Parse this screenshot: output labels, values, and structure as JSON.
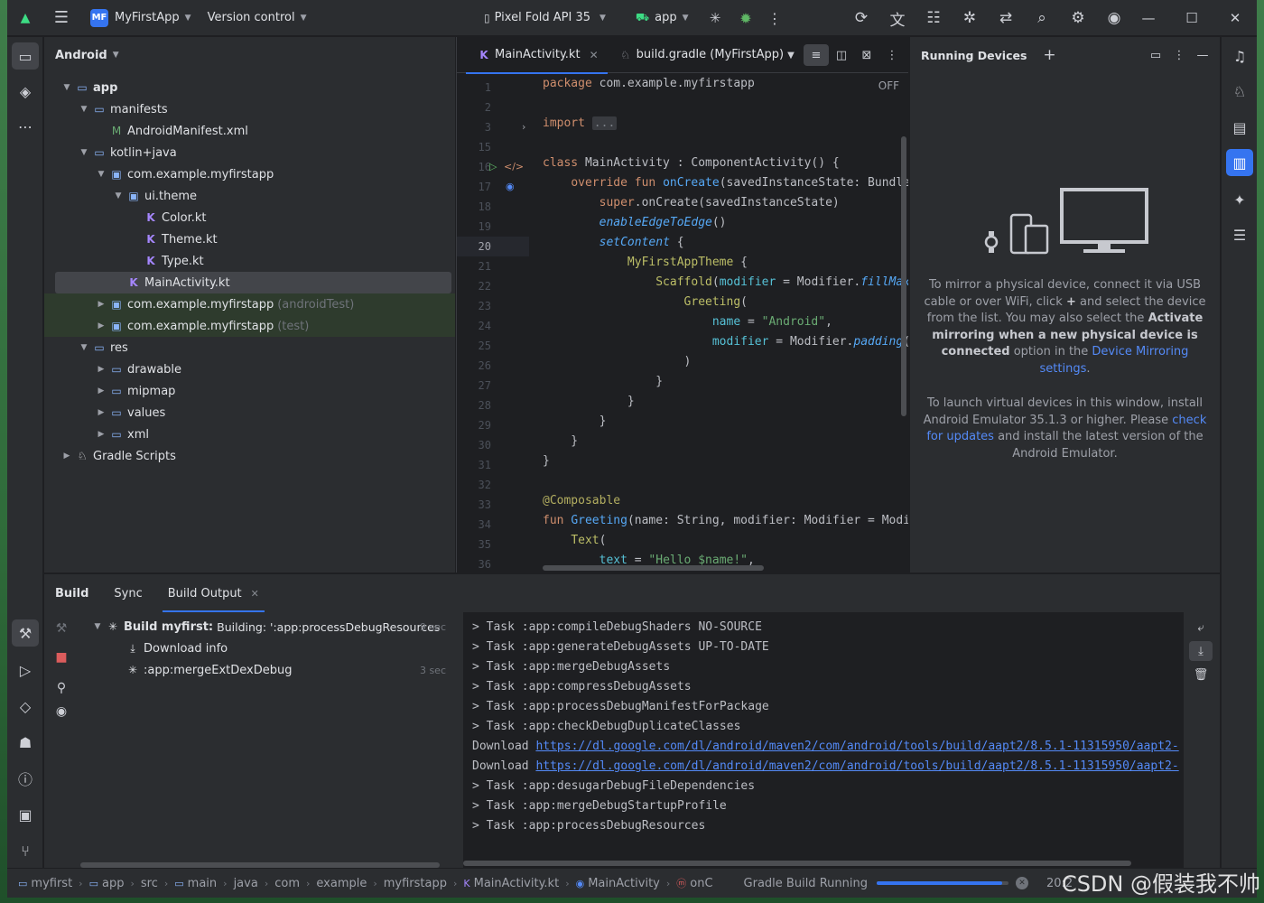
{
  "titlebar": {
    "project_badge": "MF",
    "project_name": "MyFirstApp",
    "vcs": "Version control",
    "device": "Pixel Fold API 35",
    "run_config": "app"
  },
  "project_panel": {
    "view": "Android",
    "tree": [
      {
        "label": "app",
        "depth": 0,
        "icon": "module-folder-icon",
        "twisty": "open"
      },
      {
        "label": "manifests",
        "depth": 1,
        "icon": "folder-icon",
        "twisty": "open"
      },
      {
        "label": "AndroidManifest.xml",
        "depth": 2,
        "icon": "manifest-file-icon",
        "twisty": ""
      },
      {
        "label": "kotlin+java",
        "depth": 1,
        "icon": "folder-icon",
        "twisty": "open"
      },
      {
        "label": "com.example.myfirstapp",
        "depth": 2,
        "icon": "package-icon",
        "twisty": "open"
      },
      {
        "label": "ui.theme",
        "depth": 3,
        "icon": "package-icon",
        "twisty": "open"
      },
      {
        "label": "Color.kt",
        "depth": 4,
        "icon": "kotlin-file-icon",
        "twisty": ""
      },
      {
        "label": "Theme.kt",
        "depth": 4,
        "icon": "kotlin-file-icon",
        "twisty": ""
      },
      {
        "label": "Type.kt",
        "depth": 4,
        "icon": "kotlin-file-icon",
        "twisty": ""
      },
      {
        "label": "MainActivity.kt",
        "depth": 3,
        "icon": "kotlin-file-icon",
        "twisty": "",
        "selected": true
      },
      {
        "label": "com.example.myfirstapp",
        "suffix": "(androidTest)",
        "depth": 2,
        "icon": "package-icon",
        "twisty": "closed",
        "green": true
      },
      {
        "label": "com.example.myfirstapp",
        "suffix": "(test)",
        "depth": 2,
        "icon": "package-icon",
        "twisty": "closed",
        "green": true
      },
      {
        "label": "res",
        "depth": 1,
        "icon": "resources-folder-icon",
        "twisty": "open"
      },
      {
        "label": "drawable",
        "depth": 2,
        "icon": "folder-icon",
        "twisty": "closed"
      },
      {
        "label": "mipmap",
        "depth": 2,
        "icon": "folder-icon",
        "twisty": "closed"
      },
      {
        "label": "values",
        "depth": 2,
        "icon": "folder-icon",
        "twisty": "closed"
      },
      {
        "label": "xml",
        "depth": 2,
        "icon": "folder-icon",
        "twisty": "closed"
      },
      {
        "label": "Gradle Scripts",
        "depth": 0,
        "icon": "gradle-icon",
        "twisty": "closed"
      }
    ]
  },
  "editor": {
    "tabs": [
      {
        "label": "MainActivity.kt",
        "active": true
      },
      {
        "label": "build.gradle (MyFirstApp)",
        "active": false
      }
    ],
    "off_label": "OFF",
    "line_numbers": [
      "1",
      "2",
      "3",
      "15",
      "16",
      "17",
      "18",
      "19",
      "20",
      "21",
      "22",
      "23",
      "24",
      "25",
      "26",
      "27",
      "28",
      "29",
      "30",
      "31",
      "32",
      "33",
      "34",
      "35",
      "36"
    ],
    "current_line": "20"
  },
  "devices": {
    "title": "Running Devices",
    "msg1_a": "To mirror a physical device, connect it via USB cable or over WiFi, click",
    "msg1_plus": "+",
    "msg1_b": "and select the device from the list. You may also select the",
    "msg1_bold": "Activate mirroring when a new physical device is connected",
    "msg1_c": "option in the",
    "msg1_link": "Device Mirroring settings",
    "msg1_end": ".",
    "msg2_a": "To launch virtual devices in this window, install Android Emulator 35.1.3 or higher. Please",
    "msg2_link": "check for updates",
    "msg2_b": "and install the latest version of the Android Emulator."
  },
  "build": {
    "tabs": [
      "Build",
      "Sync",
      "Build Output"
    ],
    "tree": {
      "root_bold": "Build myfirst:",
      "root_text": "Building: ':app:processDebugResources",
      "root_time": "9 sec",
      "child1": "Download info",
      "child2": ":app:mergeExtDexDebug",
      "child2_time": "3 sec"
    },
    "console": [
      {
        "text": "> Task :app:compileDebugShaders NO-SOURCE"
      },
      {
        "text": "> Task :app:generateDebugAssets UP-TO-DATE"
      },
      {
        "text": "> Task :app:mergeDebugAssets"
      },
      {
        "text": "> Task :app:compressDebugAssets"
      },
      {
        "text": "> Task :app:processDebugManifestForPackage"
      },
      {
        "text": "> Task :app:checkDebugDuplicateClasses"
      },
      {
        "text": "Download ",
        "link": "https://dl.google.com/dl/android/maven2/com/android/tools/build/aapt2/8.5.1-11315950/aapt2-"
      },
      {
        "text": "Download ",
        "link": "https://dl.google.com/dl/android/maven2/com/android/tools/build/aapt2/8.5.1-11315950/aapt2-"
      },
      {
        "text": "> Task :app:desugarDebugFileDependencies"
      },
      {
        "text": "> Task :app:mergeDebugStartupProfile"
      },
      {
        "text": "> Task :app:processDebugResources"
      }
    ]
  },
  "statusbar": {
    "crumbs": [
      "myfirst",
      "app",
      "src",
      "main",
      "java",
      "com",
      "example",
      "myfirstapp",
      "MainActivity.kt",
      "MainActivity",
      "onC"
    ],
    "progress_label": "Gradle Build Running",
    "progress": 0.95,
    "time": "20:2",
    "watermark": "CSDN @假装我不帅"
  },
  "colors": {
    "accent": "#3574f0",
    "background": "#1e1f22",
    "panel": "#2b2d30",
    "keyword": "#cf8e6d",
    "function": "#56a8f5",
    "string": "#6aab73"
  }
}
